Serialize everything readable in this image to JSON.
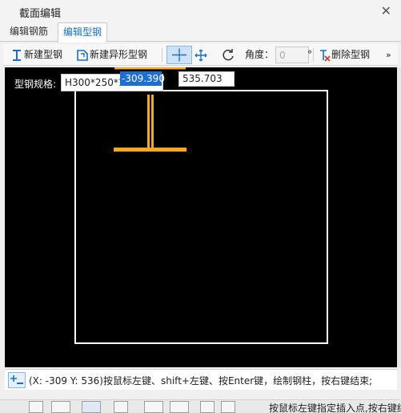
{
  "window": {
    "title": "截面编辑",
    "close_icon": "close-icon"
  },
  "tabs": [
    {
      "label": "编辑钢筋",
      "active": false
    },
    {
      "label": "编辑型钢",
      "active": true
    }
  ],
  "toolbar": {
    "new_steel": "新建型钢",
    "new_irregular_steel": "新建异形型钢",
    "snap_point_icon": "crosshair-point-icon",
    "move_icon": "move-arrows-icon",
    "rotate_icon": "rotate-icon",
    "angle_label": "角度：",
    "angle_value": "0",
    "angle_unit": "°",
    "delete_steel": "删除型钢",
    "overflow_icon": "chevron-double-right-icon"
  },
  "canvas": {
    "spec_label": "型钢规格:",
    "spec_value": "H300*250*1",
    "coord_x": "-309.390",
    "coord_y": "535.703",
    "colors": {
      "background": "#000000",
      "outline": "#ffffff",
      "steel": "#f5a623"
    }
  },
  "status": {
    "text": "(X: -309 Y: 536)按鼠标左键、shift+左键、按Enter键，绘制钢柱，按右键结束;"
  },
  "bottom": {
    "hint_text": "按鼠标左键指定插入点,按右键结束"
  }
}
